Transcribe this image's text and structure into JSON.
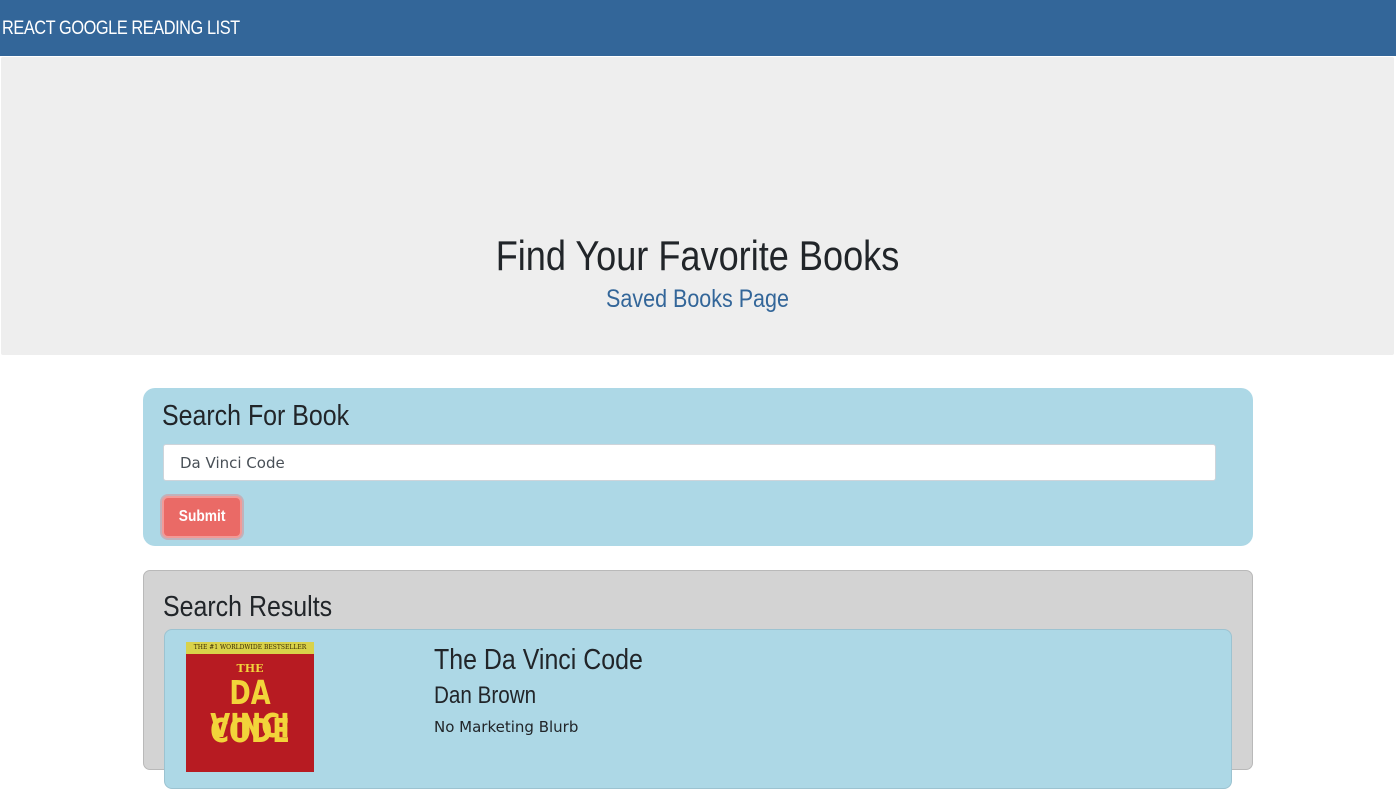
{
  "navbar": {
    "brand": "REACT GOOGLE READING LIST"
  },
  "jumbotron": {
    "title": "Find Your Favorite Books",
    "link_label": "Saved Books Page"
  },
  "search": {
    "title": "Search For Book",
    "input_value": "Da Vinci Code",
    "submit_label": "Submit"
  },
  "results": {
    "title": "Search Results",
    "books": [
      {
        "title": "The Da Vinci Code",
        "author": "Dan Brown",
        "description": "No Marketing Blurb",
        "cover": {
          "banner": "THE #1 WORLDWIDE BESTSELLER",
          "the": "THE",
          "line1": "DA VINCI",
          "line2": "CODE"
        }
      }
    ]
  },
  "colors": {
    "navbar": "#336699",
    "jumbotron": "#eeeeee",
    "card": "#add8e6",
    "results_panel": "#d3d3d3",
    "button": "#ea6a66",
    "link": "#336699"
  }
}
